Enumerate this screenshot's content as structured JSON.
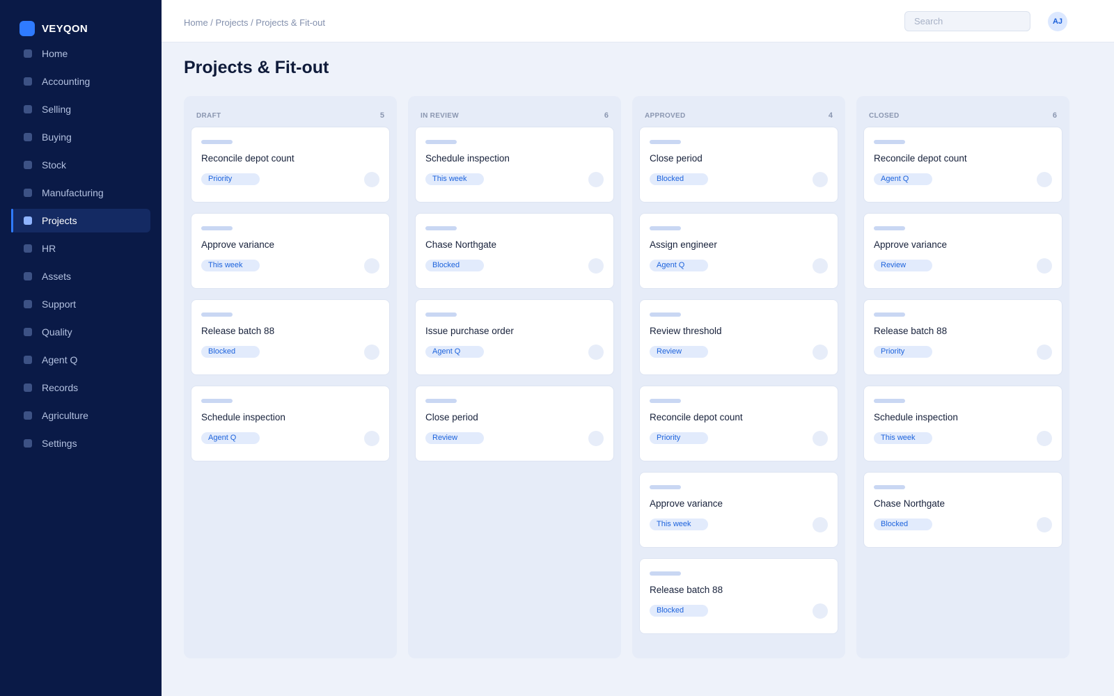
{
  "brand": {
    "name": "VEYQON",
    "logo_color": "#2f7bff"
  },
  "sidebar": {
    "items": [
      {
        "label": "Home",
        "active": false
      },
      {
        "label": "Accounting",
        "active": false
      },
      {
        "label": "Selling",
        "active": false
      },
      {
        "label": "Buying",
        "active": false
      },
      {
        "label": "Stock",
        "active": false
      },
      {
        "label": "Manufacturing",
        "active": false
      },
      {
        "label": "Projects",
        "active": true
      },
      {
        "label": "HR",
        "active": false
      },
      {
        "label": "Assets",
        "active": false
      },
      {
        "label": "Support",
        "active": false
      },
      {
        "label": "Quality",
        "active": false
      },
      {
        "label": "Agent Q",
        "active": false
      },
      {
        "label": "Records",
        "active": false
      },
      {
        "label": "Agriculture",
        "active": false
      },
      {
        "label": "Settings",
        "active": false
      }
    ]
  },
  "header": {
    "breadcrumb": "Home / Projects / Projects & Fit-out",
    "search_placeholder": "Search",
    "avatar_initials": "AJ"
  },
  "page": {
    "title": "Projects & Fit-out"
  },
  "board": {
    "columns": [
      {
        "name": "DRAFT",
        "count": "5",
        "cards": [
          {
            "title": "Reconcile depot count",
            "tag": "Priority"
          },
          {
            "title": "Approve variance",
            "tag": "This week"
          },
          {
            "title": "Release batch 88",
            "tag": "Blocked"
          },
          {
            "title": "Schedule inspection",
            "tag": "Agent Q"
          }
        ]
      },
      {
        "name": "IN REVIEW",
        "count": "6",
        "cards": [
          {
            "title": "Schedule inspection",
            "tag": "This week"
          },
          {
            "title": "Chase Northgate",
            "tag": "Blocked"
          },
          {
            "title": "Issue purchase order",
            "tag": "Agent Q"
          },
          {
            "title": "Close period",
            "tag": "Review"
          }
        ]
      },
      {
        "name": "APPROVED",
        "count": "4",
        "cards": [
          {
            "title": "Close period",
            "tag": "Blocked"
          },
          {
            "title": "Assign engineer",
            "tag": "Agent Q"
          },
          {
            "title": "Review threshold",
            "tag": "Review"
          },
          {
            "title": "Reconcile depot count",
            "tag": "Priority"
          },
          {
            "title": "Approve variance",
            "tag": "This week"
          },
          {
            "title": "Release batch 88",
            "tag": "Blocked"
          }
        ]
      },
      {
        "name": "CLOSED",
        "count": "6",
        "cards": [
          {
            "title": "Reconcile depot count",
            "tag": "Agent Q"
          },
          {
            "title": "Approve variance",
            "tag": "Review"
          },
          {
            "title": "Release batch 88",
            "tag": "Priority"
          },
          {
            "title": "Schedule inspection",
            "tag": "This week"
          },
          {
            "title": "Chase Northgate",
            "tag": "Blocked"
          }
        ]
      }
    ]
  },
  "colors": {
    "sidebar_bg": "#0a1a47",
    "accent": "#2f7bff",
    "page_bg": "#eef2fa",
    "column_bg": "#e6ecf8",
    "tag_bg": "#e2ebfc",
    "tag_text": "#1d63dc"
  }
}
